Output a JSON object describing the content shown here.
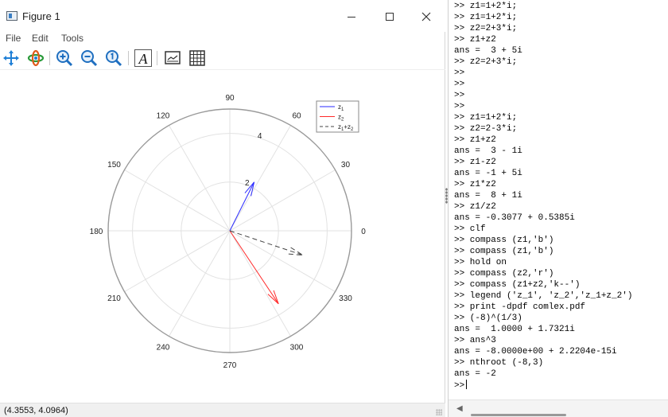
{
  "figure": {
    "title": "Figure 1",
    "menu": [
      "File",
      "Edit",
      "Tools"
    ],
    "toolbar": [
      "pan-icon",
      "rotate-icon",
      "zoom-in-icon",
      "zoom-out-icon",
      "zoom-reset-icon",
      "insert-text-icon",
      "toggle-axes-icon",
      "toggle-grid-icon"
    ],
    "status": "(4.3553, 4.0964)"
  },
  "chart_data": {
    "type": "compass",
    "rmax": 5,
    "radial_ticks": [
      2,
      4
    ],
    "radial_tick_labels": [
      "2",
      "4"
    ],
    "angle_ticks": [
      0,
      30,
      60,
      90,
      120,
      150,
      180,
      210,
      240,
      270,
      300,
      330
    ],
    "angle_tick_labels": [
      "0",
      "30",
      "60",
      "90",
      "120",
      "150",
      "180",
      "210",
      "240",
      "270",
      "300",
      "330"
    ],
    "grid": true,
    "legend_position": "top-right",
    "series": [
      {
        "name": "z1",
        "x": 1,
        "y": 2,
        "color": "#2a2aff",
        "style": "solid"
      },
      {
        "name": "z2",
        "x": 2,
        "y": -3,
        "color": "#ff2a2a",
        "style": "solid"
      },
      {
        "name": "z1+z2",
        "x": 3,
        "y": -1,
        "color": "#444444",
        "style": "dashed"
      }
    ],
    "legend_labels": [
      {
        "base": "z",
        "sub": "1",
        "tail": ""
      },
      {
        "base": "z",
        "sub": "2",
        "tail": ""
      },
      {
        "base": "z",
        "sub": "1",
        "tail": "+z",
        "sub2": "2"
      }
    ]
  },
  "command_window": {
    "lines": [
      ">> z1=1+2*i;",
      ">> z1=1+2*i;",
      ">> z2=2+3*i;",
      ">> z1+z2",
      "ans =  3 + 5i",
      ">> z2=2+3*i;",
      ">>",
      ">>",
      ">>",
      ">>",
      ">> z1=1+2*i;",
      ">> z2=2-3*i;",
      ">> z1+z2",
      "ans =  3 - 1i",
      ">> z1-z2",
      "ans = -1 + 5i",
      ">> z1*z2",
      "ans =  8 + 1i",
      ">> z1/z2",
      "ans = -0.3077 + 0.5385i",
      ">> clf",
      ">> compass (z1,'b')",
      ">> compass (z1,'b')",
      ">> hold on",
      ">> compass (z2,'r')",
      ">> compass (z1+z2,'k--')",
      ">> legend ('z_1', 'z_2','z_1+z_2')",
      ">> print -dpdf comlex.pdf",
      ">> (-8)^(1/3)",
      "ans =  1.0000 + 1.7321i",
      ">> ans^3",
      "ans = -8.0000e+00 + 2.2204e-15i",
      ">> nthroot (-8,3)",
      "ans = -2"
    ],
    "prompt": ">>"
  }
}
